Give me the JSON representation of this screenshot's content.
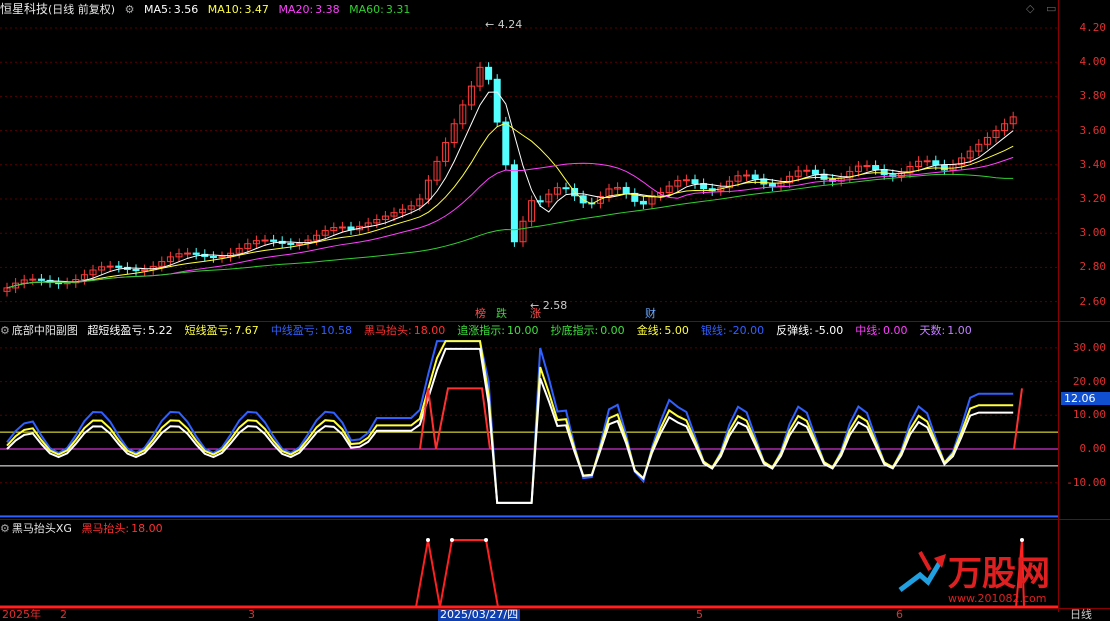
{
  "header": {
    "stock": "恒星科技",
    "mode": "(日线 前复权)",
    "ma5_label": "MA5:",
    "ma5": "3.56",
    "ma10_label": "MA10:",
    "ma10": "3.47",
    "ma20_label": "MA20:",
    "ma20": "3.38",
    "ma60_label": "MA60:",
    "ma60": "3.31"
  },
  "main_axis": [
    "4.20",
    "4.00",
    "3.80",
    "3.60",
    "3.40",
    "3.20",
    "3.00",
    "2.80",
    "2.60"
  ],
  "annotations": {
    "high": "4.24",
    "low": "2.58"
  },
  "markers": [
    {
      "text": "榜",
      "color": "#ff5050"
    },
    {
      "text": "跌",
      "color": "#40d040"
    },
    {
      "text": "涨",
      "color": "#ff5050"
    },
    {
      "text": "财",
      "color": "#6aa8ff"
    }
  ],
  "indicator": {
    "name": "底部中阳副图",
    "items": [
      {
        "label": "超短线盈亏:",
        "value": "5.22",
        "color": "#ffffff"
      },
      {
        "label": "短线盈亏:",
        "value": "7.67",
        "color": "#ffff40"
      },
      {
        "label": "中线盈亏:",
        "value": "10.58",
        "color": "#3060ff"
      },
      {
        "label": "黑马抬头:",
        "value": "18.00",
        "color": "#ff3030"
      },
      {
        "label": "追涨指示:",
        "value": "10.00",
        "color": "#40e040"
      },
      {
        "label": "抄底指示:",
        "value": "0.00",
        "color": "#40e040"
      },
      {
        "label": "金线:",
        "value": "5.00",
        "color": "#ffff40"
      },
      {
        "label": "银线:",
        "value": "-20.00",
        "color": "#3060ff"
      },
      {
        "label": "反弹线:",
        "value": "-5.00",
        "color": "#ffffff"
      },
      {
        "label": "中线:",
        "value": "0.00",
        "color": "#ff40ff"
      },
      {
        "label": "天数:",
        "value": "1.00",
        "color": "#c080ff"
      }
    ],
    "axis": [
      "30.00",
      "20.00",
      "10.00",
      "0.00",
      "-10.00"
    ],
    "current": "12.06"
  },
  "xg": {
    "name": "黑马抬头XG",
    "label": "黑马抬头:",
    "value": "18.00"
  },
  "xaxis": {
    "labels": [
      "2025年",
      "2",
      "3",
      "2025/03/27/四",
      "5",
      "6"
    ],
    "period": "日线"
  },
  "watermark": {
    "brand": "万股网",
    "url": "www.201082.com"
  },
  "colors": {
    "up": "#ff3a3a",
    "down": "#54ffff",
    "ma5": "#ffffff",
    "ma10": "#ffff40",
    "ma20": "#ff40ff",
    "ma60": "#30d030",
    "grid": "#8a0000"
  }
}
